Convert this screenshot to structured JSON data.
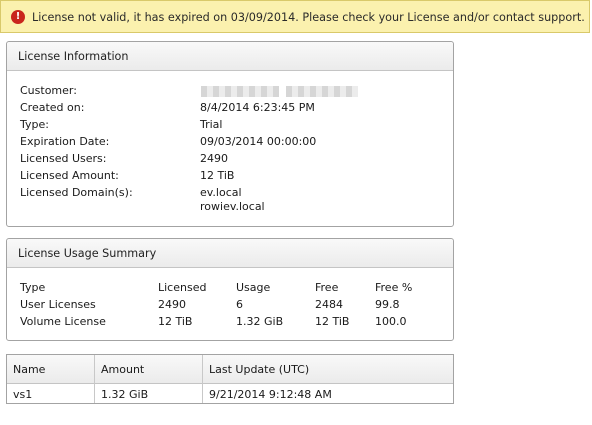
{
  "banner": {
    "icon": "error-icon",
    "icon_glyph": "!",
    "message": "License not valid, it has expired on 03/09/2014. Please check your License and/or contact support."
  },
  "license_info": {
    "title": "License Information",
    "fields": [
      {
        "label": "Customer:",
        "value": ""
      },
      {
        "label": "Created on:",
        "value": "8/4/2014 6:23:45 PM"
      },
      {
        "label": "Type:",
        "value": "Trial"
      },
      {
        "label": "Expiration Date:",
        "value": "09/03/2014 00:00:00"
      },
      {
        "label": "Licensed Users:",
        "value": "2490"
      },
      {
        "label": "Licensed Amount:",
        "value": "12 TiB"
      },
      {
        "label": "Licensed Domain(s):",
        "value": "ev.local",
        "value2": "rowiev.local"
      }
    ]
  },
  "usage_summary": {
    "title": "License Usage Summary",
    "headers": [
      "Type",
      "Licensed",
      "Usage",
      "Free",
      "Free %"
    ],
    "rows": [
      [
        "User Licenses",
        "2490",
        "6",
        "2484",
        "99.8"
      ],
      [
        "Volume License",
        "12 TiB",
        "1.32 GiB",
        "12 TiB",
        "100.0"
      ]
    ]
  },
  "volumes_table": {
    "headers": [
      "Name",
      "Amount",
      "Last Update (UTC)"
    ],
    "rows": [
      [
        "vs1",
        "1.32 GiB",
        "9/21/2014 9:12:48 AM"
      ]
    ]
  }
}
